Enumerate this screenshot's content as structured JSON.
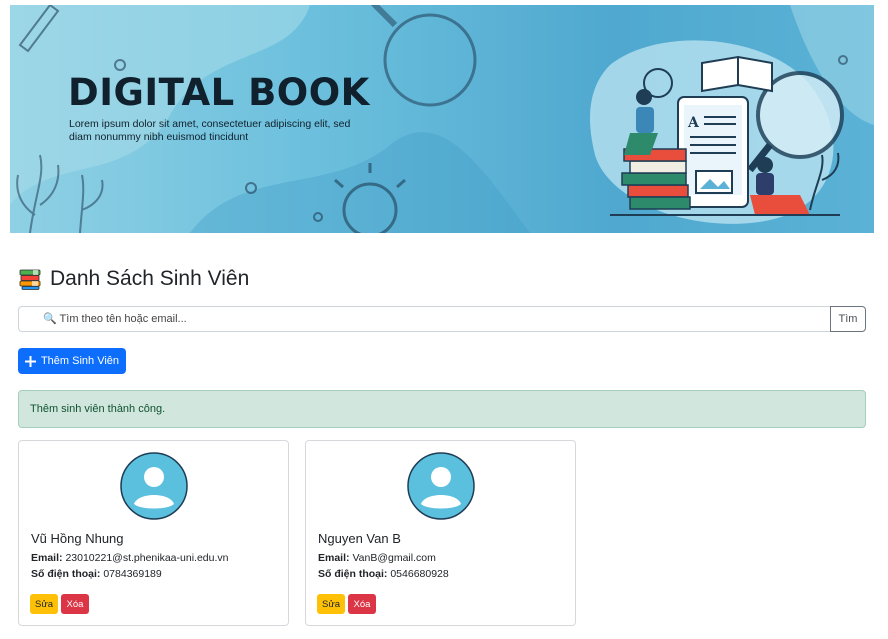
{
  "banner": {
    "title": "DIGITAL BOOK",
    "subtitle": "Lorem ipsum dolor sit amet, consectetuer adipiscing elit, sed diam nonummy nibh euismod tincidunt"
  },
  "heading": {
    "icon": "books-icon",
    "text": "Danh Sách Sinh Viên"
  },
  "search": {
    "placeholder": "🔍 Tìm theo tên hoặc email...",
    "button_label": "Tìm"
  },
  "add_button": {
    "label": "Thêm Sinh Viên"
  },
  "alert": {
    "message": "Thêm sinh viên thành công."
  },
  "students": [
    {
      "name": "Vũ Hồng Nhung",
      "email_label": "Email:",
      "email": "23010221@st.phenikaa-uni.edu.vn",
      "phone_label": "Số điện thoại:",
      "phone": "0784369189",
      "edit_label": "Sửa",
      "delete_label": "Xóa"
    },
    {
      "name": "Nguyen Van B",
      "email_label": "Email:",
      "email": "VanB@gmail.com",
      "phone_label": "Số điện thoại:",
      "phone": "0546680928",
      "edit_label": "Sửa",
      "delete_label": "Xóa"
    }
  ],
  "colors": {
    "primary": "#0d6efd",
    "success_bg": "#d1e7dd",
    "warning": "#ffc107",
    "danger": "#dc3545",
    "avatar": "#5bc0de"
  }
}
